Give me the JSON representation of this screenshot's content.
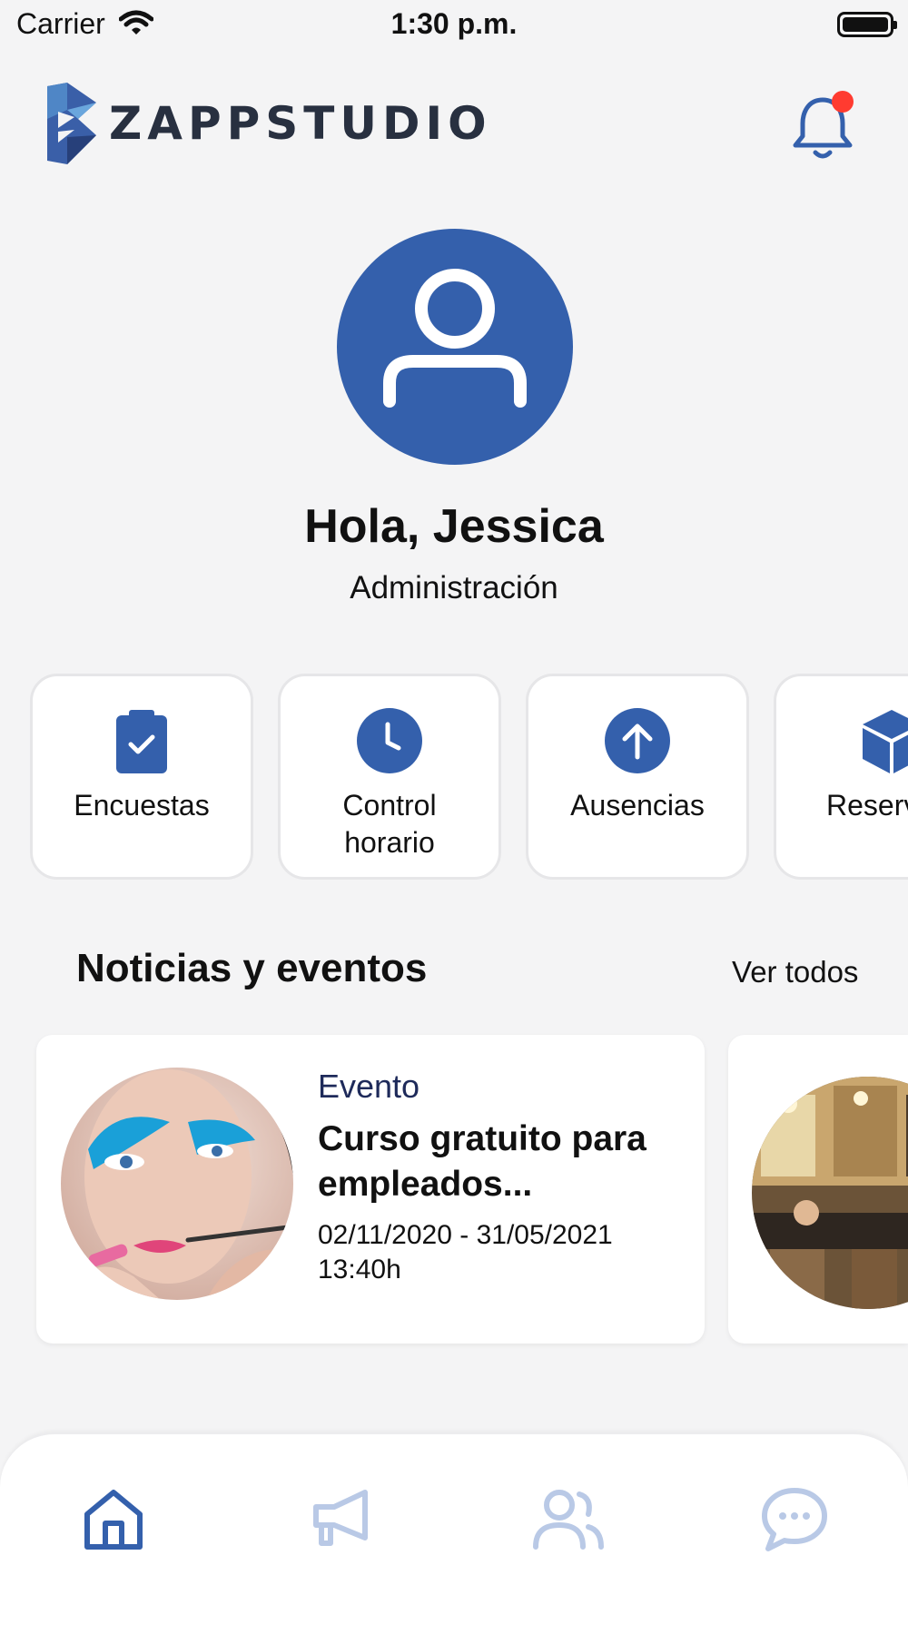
{
  "status_bar": {
    "carrier": "Carrier",
    "time": "1:30 p.m."
  },
  "header": {
    "logo_text": "ZAPPSTUDIO",
    "notification_badge": true
  },
  "profile": {
    "greeting": "Hola, Jessica",
    "department": "Administración"
  },
  "quick_actions": [
    {
      "label": "Encuestas",
      "icon": "clipboard-check-icon"
    },
    {
      "label": "Control\nhorario",
      "icon": "clock-icon"
    },
    {
      "label": "Ausencias",
      "icon": "arrow-up-circle-icon"
    },
    {
      "label": "Reservas",
      "icon": "cube-icon"
    }
  ],
  "news": {
    "title": "Noticias y eventos",
    "see_all": "Ver todos",
    "items": [
      {
        "type": "Evento",
        "title": "Curso gratuito para empleados...",
        "dates": "02/11/2020 - 31/05/2021",
        "time": "13:40h"
      }
    ]
  },
  "bottom_nav": [
    {
      "name": "home",
      "icon": "home-icon",
      "active": true
    },
    {
      "name": "announcements",
      "icon": "megaphone-icon",
      "active": false
    },
    {
      "name": "people",
      "icon": "users-icon",
      "active": false
    },
    {
      "name": "chat",
      "icon": "chat-icon",
      "active": false
    }
  ],
  "colors": {
    "primary": "#3460ac",
    "primary_light": "#b9c9e6",
    "badge": "#ff3b30",
    "background": "#f4f4f5"
  }
}
